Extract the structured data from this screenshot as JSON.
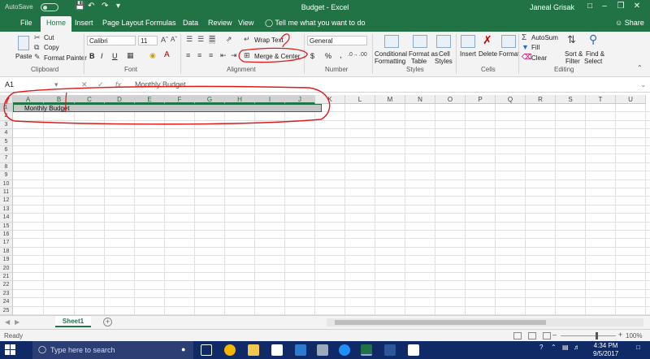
{
  "titlebar": {
    "autosave": "AutoSave",
    "autosave_state": "Off",
    "doc_title": "Budget - Excel",
    "user": "Janeal Grisak"
  },
  "tabs": [
    "File",
    "Home",
    "Insert",
    "Page Layout",
    "Formulas",
    "Data",
    "Review",
    "View"
  ],
  "active_tab": "Home",
  "tell_me": "Tell me what you want to do",
  "share": "Share",
  "ribbon": {
    "clipboard": {
      "label": "Clipboard",
      "paste": "Paste",
      "cut": "Cut",
      "copy": "Copy",
      "format_painter": "Format Painter"
    },
    "font": {
      "label": "Font",
      "family": "Calibri",
      "size": "11",
      "bold": "B",
      "italic": "I",
      "underline": "U"
    },
    "alignment": {
      "label": "Alignment",
      "wrap_text": "Wrap Text",
      "merge_center": "Merge & Center"
    },
    "number": {
      "label": "Number",
      "format": "General",
      "currency": "$",
      "percent": "%",
      "comma": ","
    },
    "styles": {
      "label": "Styles",
      "conditional": "Conditional",
      "conditional2": "Formatting",
      "format_as": "Format as",
      "format_as2": "Table",
      "cell": "Cell",
      "cell2": "Styles"
    },
    "cells": {
      "label": "Cells",
      "insert": "Insert",
      "delete": "Delete",
      "format": "Format"
    },
    "editing": {
      "label": "Editing",
      "autosum": "AutoSum",
      "fill": "Fill",
      "clear": "Clear",
      "sort_filter": "Sort &",
      "sort_filter2": "Filter",
      "find_select": "Find &",
      "find_select2": "Select"
    }
  },
  "formula_bar": {
    "name_box": "A1",
    "fx": "fx",
    "content": "Monthly Budget"
  },
  "columns": [
    "A",
    "B",
    "C",
    "D",
    "E",
    "F",
    "G",
    "H",
    "I",
    "J",
    "K",
    "L",
    "M",
    "N",
    "O",
    "P",
    "Q",
    "R",
    "S",
    "T",
    "U"
  ],
  "rows": [
    "1",
    "2",
    "3",
    "4",
    "5",
    "6",
    "7",
    "8",
    "9",
    "10",
    "11",
    "12",
    "13",
    "14",
    "15",
    "16",
    "17",
    "18",
    "19",
    "20",
    "21",
    "22",
    "23",
    "24",
    "25"
  ],
  "cells": {
    "A1": "Monthly Budget"
  },
  "sheets": [
    "Sheet1"
  ],
  "status": {
    "ready": "Ready",
    "zoom": "100%"
  },
  "taskbar": {
    "search_placeholder": "Type here to search",
    "time": "4:34 PM",
    "date": "9/5/2017"
  },
  "annotation_colors": {
    "pen": "#e01818"
  },
  "theme": {
    "accent": "#217346",
    "taskbar": "#0f2a66"
  }
}
